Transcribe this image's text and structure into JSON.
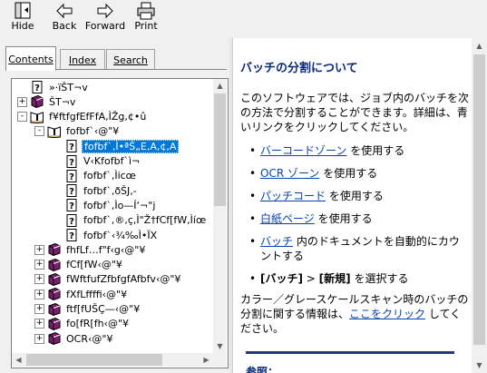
{
  "toolbar": {
    "hide": "Hide",
    "back": "Back",
    "forward": "Forward",
    "print": "Print"
  },
  "tabs": {
    "contents": "Contents",
    "index": "Index",
    "search": "Search"
  },
  "tree": {
    "items": [
      {
        "label": "»·ïŠT¬v",
        "icon": "page-help-icon",
        "expander": ""
      },
      {
        "label": "ŠT¬v",
        "icon": "book-closed-icon",
        "expander": "+"
      },
      {
        "label": "f¥ftfgfEfFfA,ÌŽg,¢•û",
        "icon": "book-open-icon",
        "expander": "-"
      },
      {
        "label": "fofbf`‹@\"¥",
        "icon": "book-open-icon",
        "expander": "-"
      },
      {
        "label": "fofbf`,Ì•ªŠ„E,A,¢,A",
        "icon": "page-help-icon",
        "expander": "",
        "selected": true
      },
      {
        "label": "V‹Kfofbf`ì¬",
        "icon": "page-help-icon",
        "expander": ""
      },
      {
        "label": "fofbf`,Ìicœ",
        "icon": "page-help-icon",
        "expander": ""
      },
      {
        "label": "fofbf`,ðŠJ‚-",
        "icon": "page-help-icon",
        "expander": ""
      },
      {
        "label": "fofbf`,Ìo—Í‘¬\"j",
        "icon": "page-help-icon",
        "expander": ""
      },
      {
        "label": "fofbf`,®,ç,Ì\"Ž†fCf[fW,Ìíœ",
        "icon": "page-help-icon",
        "expander": ""
      },
      {
        "label": "fofbf`‹¾‰Ì•ÏX",
        "icon": "page-help-icon",
        "expander": ""
      },
      {
        "label": "fhfLf…f\"f‹g‹@\"¥",
        "icon": "book-closed-icon",
        "expander": "+"
      },
      {
        "label": "fCf[fW‹@\"¥",
        "icon": "book-closed-icon",
        "expander": "+"
      },
      {
        "label": "fWftfufZfbfgfAfbfv‹@\"¥",
        "icon": "book-closed-icon",
        "expander": "+"
      },
      {
        "label": "fXfLffffi‹@\"¥",
        "icon": "book-closed-icon",
        "expander": "+"
      },
      {
        "label": "ftf[fUŠÇ—‹@\"¥",
        "icon": "book-closed-icon",
        "expander": "+"
      },
      {
        "label": "fo[fR[fh‹@\"¥",
        "icon": "book-closed-icon",
        "expander": "+"
      },
      {
        "label": "OCR‹@\"¥",
        "icon": "book-closed-icon",
        "expander": "+"
      }
    ]
  },
  "content": {
    "title": "バッチの分割について",
    "intro": "このソフトウェアでは、ジョブ内のバッチを次の方法で分割することができます。詳細は、青いリンクをクリックしてください。",
    "bullets": [
      {
        "link": "バーコードゾーン",
        "rest": " を使用する"
      },
      {
        "link": "OCR ゾーン",
        "rest": " を使用する"
      },
      {
        "link": "パッチコード",
        "rest": " を使用する"
      },
      {
        "link": "白紙ページ",
        "rest": " を使用する"
      },
      {
        "link": "バッチ",
        "rest": " 内のドキュメントを自動的にカウントする"
      },
      {
        "bold1": "[バッチ]",
        "mid": " > ",
        "bold2": "[新規]",
        "rest": " を選択する"
      }
    ],
    "outro_pre": "カラー／グレースケールスキャン時のバッチの分割に関する情報は、",
    "outro_link": "ここをクリック",
    "outro_post": " してください。",
    "cutoff": "参照："
  }
}
